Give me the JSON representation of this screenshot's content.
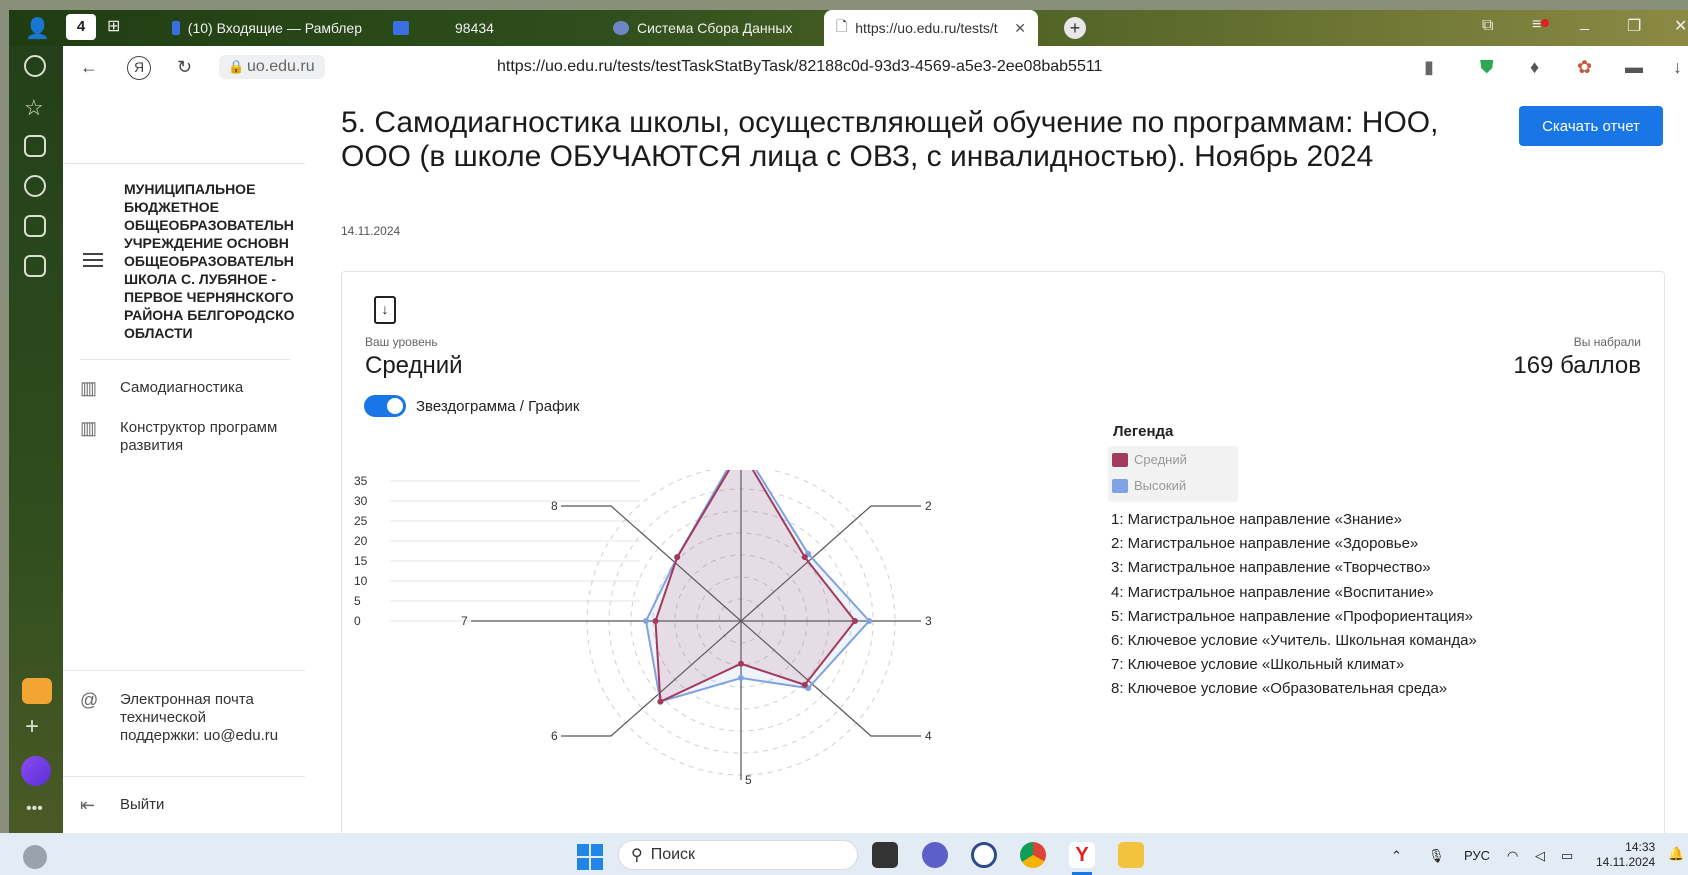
{
  "browser": {
    "tab_count": "4",
    "tabs": [
      {
        "label": "(10) Входящие — Рамблер",
        "icon": "mail-icon"
      },
      {
        "label": "98434",
        "icon": "mail-icon"
      },
      {
        "label": "Система Сбора Данных",
        "icon": "site-icon"
      },
      {
        "label": "https://uo.edu.ru/tests/t",
        "icon": "page-icon"
      }
    ],
    "domain": "uo.edu.ru",
    "url": "https://uo.edu.ru/tests/testTaskStatByTask/82188c0d-93d3-4569-a5e3-2ee08bab5511"
  },
  "sidebar": {
    "org_name": "МУНИЦИПАЛЬНОЕ БЮДЖЕТНОЕ ОБЩЕОБРАЗОВАТЕЛЬН УЧРЕЖДЕНИЕ ОСНОВН ОБЩЕОБРАЗОВАТЕЛЬН ШКОЛА С. ЛУБЯНОЕ - ПЕРВОЕ ЧЕРНЯНСКОГО РАЙОНА БЕЛГОРОДСКО ОБЛАСТИ",
    "items": [
      {
        "label": "Самодиагностика"
      },
      {
        "label": "Конструктор программ развития"
      }
    ],
    "support_label": "Электронная почта технической поддержки: uo@edu.ru",
    "logout_label": "Выйти"
  },
  "page": {
    "title": "5. Самодиагностика школы, осуществляющей обучение по программам: НОО, ООО (в школе ОБУЧАЮТСЯ лица с ОВЗ, с инвалидностью). Ноябрь 2024",
    "date": "14.11.2024",
    "download_button": "Скачать отчет",
    "level_label": "Ваш уровень",
    "level_value": "Средний",
    "score_label": "Вы набрали",
    "score_value": "169 баллов",
    "toggle_label": "Звездограмма / График",
    "legend_title": "Легенда"
  },
  "chart_data": {
    "type": "radar",
    "axes": [
      "1",
      "2",
      "3",
      "4",
      "5",
      "6",
      "7",
      "8"
    ],
    "axis_descriptions": [
      "1: Магистральное направление «Знание»",
      "2: Магистральное направление «Здоровье»",
      "3: Магистральное направление «Творчество»",
      "4: Магистральное направление «Воспитание»",
      "5: Магистральное направление «Профориентация»",
      "6: Ключевое условие «Учитель. Школьная команда»",
      "7: Ключевое условие «Школьный климат»",
      "8: Ключевое условие «Образовательная среда»"
    ],
    "ticks": [
      "35",
      "30",
      "25",
      "20",
      "15",
      "10",
      "5",
      "0"
    ],
    "series": [
      {
        "name": "Средний",
        "color": "#a23a5c",
        "values": [
          36,
          19,
          24,
          19,
          9,
          24,
          18,
          19
        ]
      },
      {
        "name": "Высокий",
        "color": "#7fa3e2",
        "values": [
          37,
          20,
          27,
          20,
          12,
          24,
          20,
          19
        ]
      }
    ],
    "ylim": [
      0,
      40
    ]
  },
  "taskbar": {
    "search_label": "Поиск",
    "lang": "РУС",
    "time": "14:33",
    "date": "14.11.2024"
  }
}
